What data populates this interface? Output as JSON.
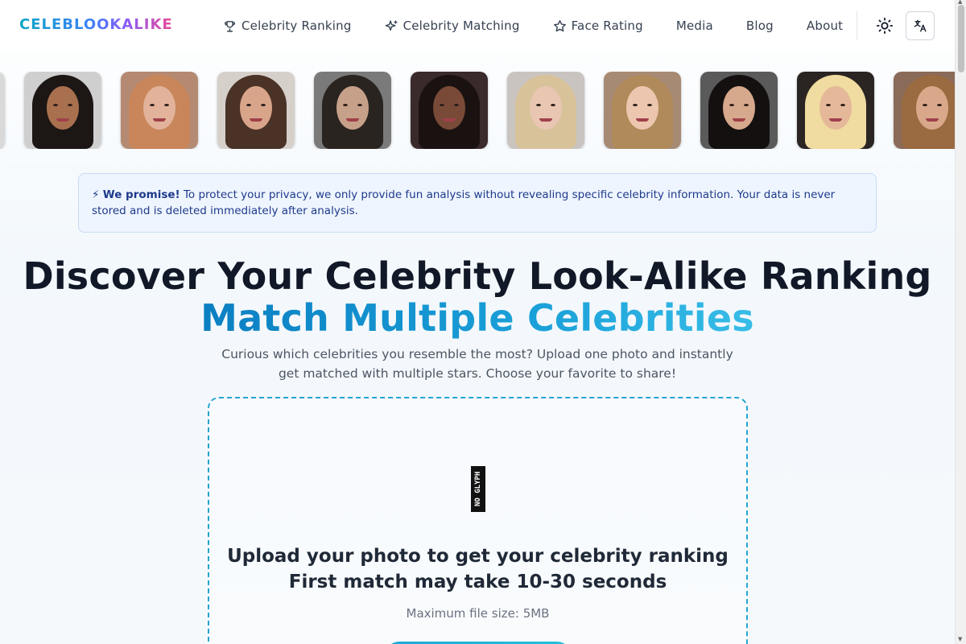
{
  "brand": {
    "logo": "CELEBLOOKALIKE"
  },
  "nav": {
    "items": [
      {
        "label": "Celebrity Ranking",
        "icon": "trophy-icon"
      },
      {
        "label": "Celebrity Matching",
        "icon": "sparkles-icon"
      },
      {
        "label": "Face Rating",
        "icon": "star-icon"
      },
      {
        "label": "Media",
        "icon": ""
      },
      {
        "label": "Blog",
        "icon": ""
      },
      {
        "label": "About",
        "icon": ""
      }
    ],
    "theme_toggle_icon": "sun-icon",
    "language_icon": "translate-icon"
  },
  "faces": {
    "count": 10
  },
  "notice": {
    "icon": "⚡",
    "strong": "We promise!",
    "text": " To protect your privacy, we only provide fun analysis without revealing specific celebrity information. Your data is never stored and is deleted immediately after analysis."
  },
  "hero": {
    "title": "Discover Your Celebrity Look-Alike Ranking",
    "subtitle": "Match Multiple Celebrities",
    "description": "Curious which celebrities you resemble the most? Upload one photo and instantly get matched with multiple stars. Choose your favorite to share!"
  },
  "upload": {
    "icon_glyph": "NO GLYPH",
    "title_line1": "Upload your photo to get your celebrity ranking",
    "title_line2": "First match may take 10-30 seconds",
    "max_size": "Maximum file size: 5MB"
  },
  "colors": {
    "accent": "#1ea7d6",
    "notice_bg": "#eef5ff",
    "notice_text": "#1e3a8a"
  }
}
